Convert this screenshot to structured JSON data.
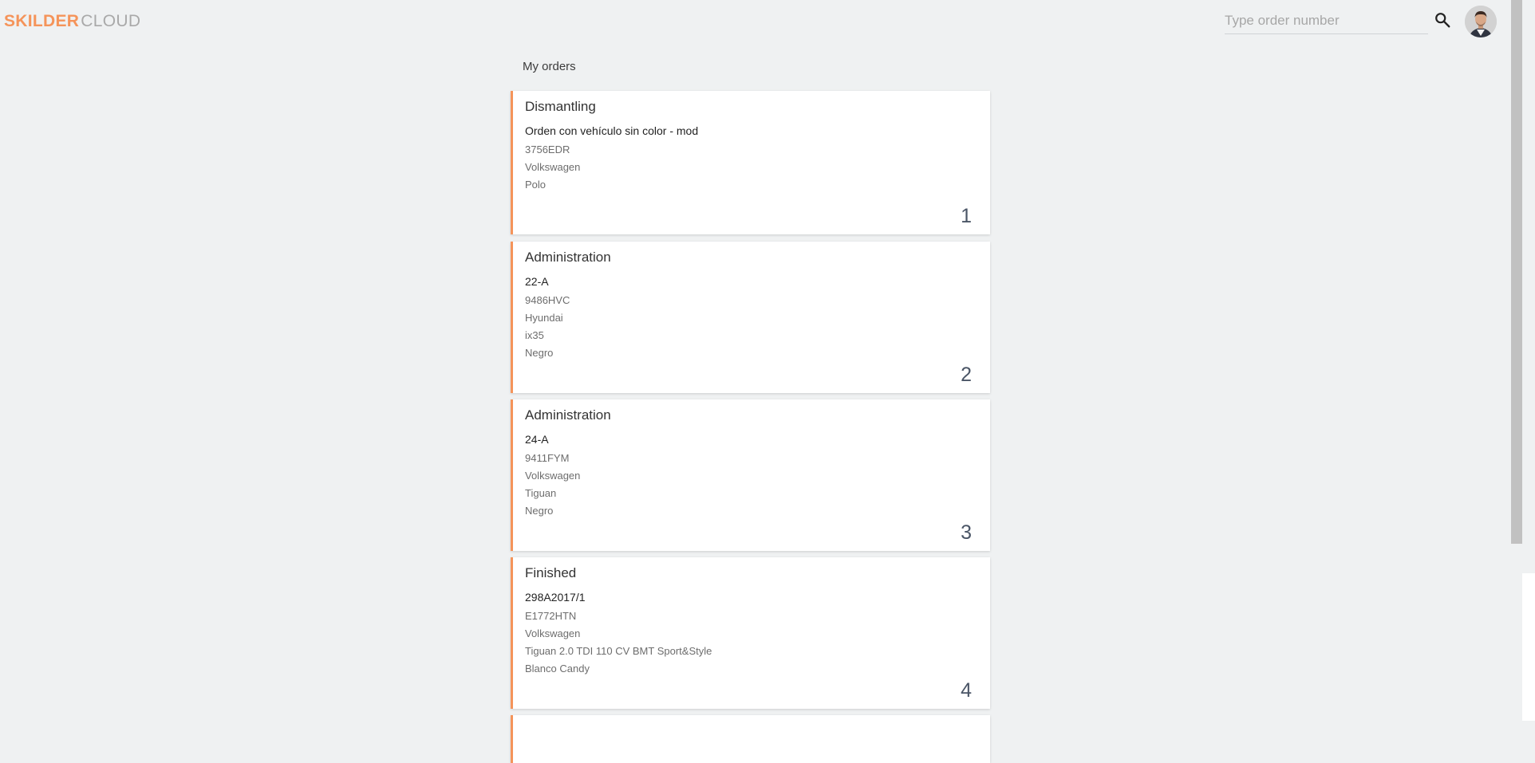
{
  "header": {
    "logo_part1": "SKILDER",
    "logo_part2": "CLOUD",
    "search_placeholder": "Type order number"
  },
  "page": {
    "title": "My orders"
  },
  "orders": [
    {
      "status": "Dismantling",
      "reference": "Orden con vehículo sin color - mod",
      "plate": "3756EDR",
      "brand": "Volkswagen",
      "model": "Polo",
      "color": "",
      "index": "1"
    },
    {
      "status": "Administration",
      "reference": "22-A",
      "plate": "9486HVC",
      "brand": "Hyundai",
      "model": "ix35",
      "color": "Negro",
      "index": "2"
    },
    {
      "status": "Administration",
      "reference": "24-A",
      "plate": "9411FYM",
      "brand": "Volkswagen",
      "model": "Tiguan",
      "color": "Negro",
      "index": "3"
    },
    {
      "status": "Finished",
      "reference": "298A2017/1",
      "plate": "E1772HTN",
      "brand": "Volkswagen",
      "model": "Tiguan 2.0 TDI 110 CV BMT Sport&Style",
      "color": "Blanco Candy",
      "index": "4"
    }
  ],
  "colors": {
    "accent": "#f5945a",
    "background": "#eff1f2"
  }
}
